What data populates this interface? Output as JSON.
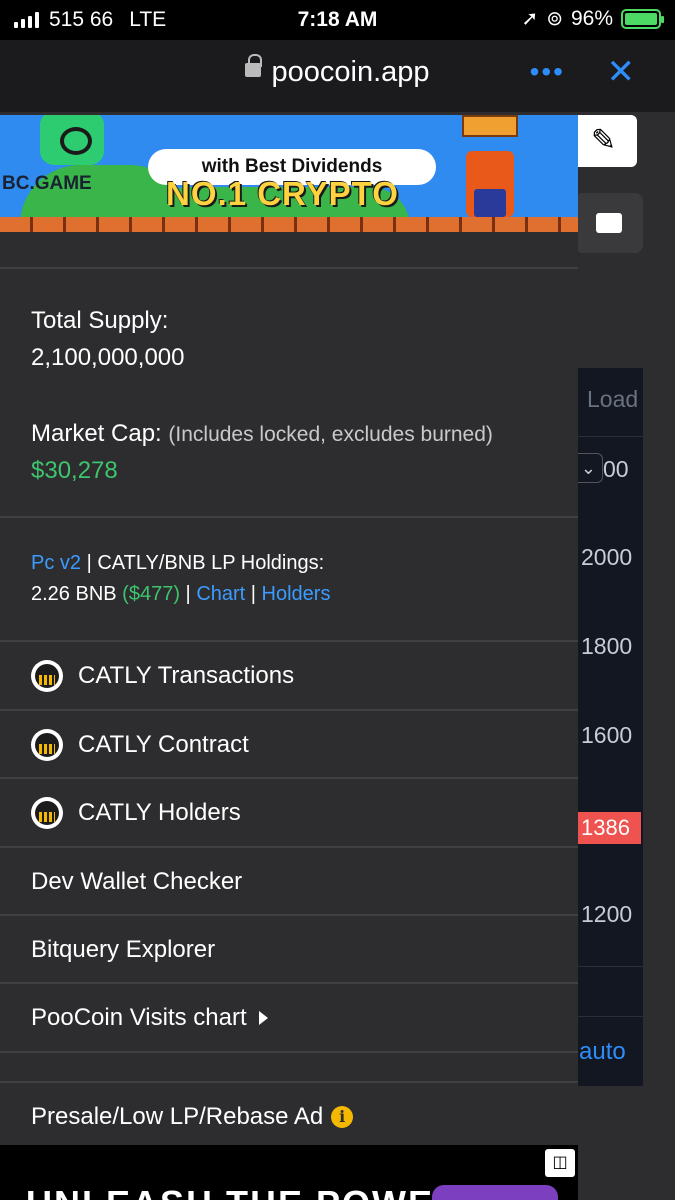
{
  "status_bar": {
    "carrier": "515 66",
    "network": "LTE",
    "time": "7:18 AM",
    "battery": "96%",
    "signal_bars": 4
  },
  "browser": {
    "url": "poocoin.app",
    "more_icon": "ellipsis-icon",
    "close_icon": "close-icon",
    "accent_color": "#2e8dfb"
  },
  "banner": {
    "brand": "BC.GAME",
    "tagline": "with Best Dividends",
    "headline": "NO.1 CRYPTO"
  },
  "token_info": {
    "total_supply_label": "Total Supply:",
    "total_supply_value": "2,100,000,000",
    "market_cap_label": "Market Cap:",
    "market_cap_note": "(Includes locked, excludes burned)",
    "market_cap_value": "$30,278"
  },
  "lp": {
    "version_link": "Pc v2",
    "sep1": "|",
    "pair_label": "CATLY/BNB LP Holdings:",
    "bnb_amount": "2.26 BNB",
    "usd_amount": "($477)",
    "sep2": "|",
    "chart_link": "Chart",
    "sep3": "|",
    "holders_link": "Holders"
  },
  "menu": {
    "transactions": "CATLY Transactions",
    "contract": "CATLY Contract",
    "holders": "CATLY Holders",
    "dev_wallet": "Dev Wallet Checker",
    "bitquery": "Bitquery Explorer",
    "visits_chart": "PooCoin Visits chart",
    "presale_ad": "Presale/Low LP/Rebase Ad",
    "info_glyph": "i"
  },
  "background_chart": {
    "loading": "Load",
    "interval": "00",
    "price_labels": [
      "2000",
      "1800",
      "1600",
      "1200"
    ],
    "current_price": "1386",
    "scale_mode": "auto",
    "current_price_color": "#ef5350"
  },
  "bottom_ad": {
    "text": "UNLEASH THE POWER"
  },
  "colors": {
    "green": "#3ec46d",
    "link_blue": "#3b9cff",
    "drawer_bg": "#2d2d2f"
  }
}
